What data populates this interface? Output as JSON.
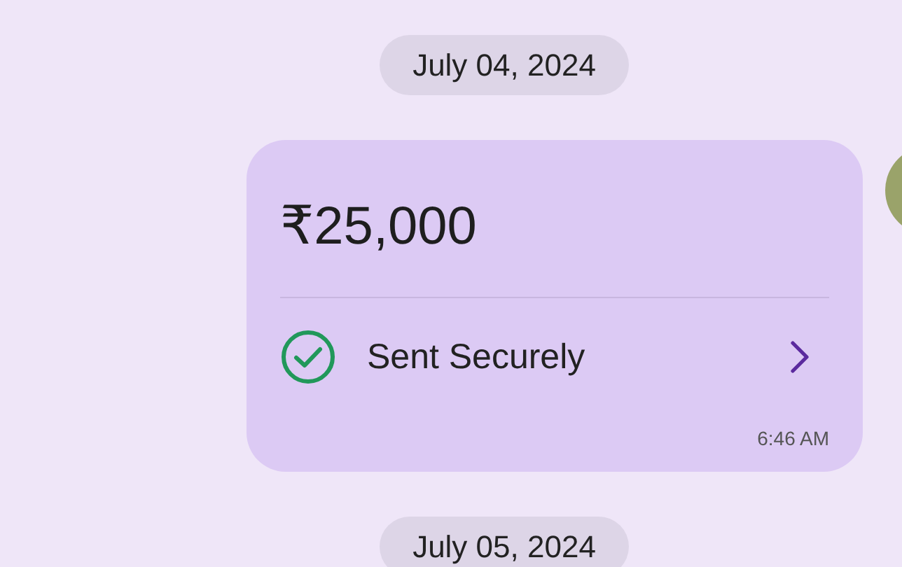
{
  "chat": [
    {
      "kind": "date",
      "label": "July 04, 2024"
    },
    {
      "kind": "payment",
      "amount": "₹25,000",
      "status": "Sent Securely",
      "time": "6:46 AM"
    },
    {
      "kind": "date",
      "label": "July 05, 2024"
    }
  ]
}
